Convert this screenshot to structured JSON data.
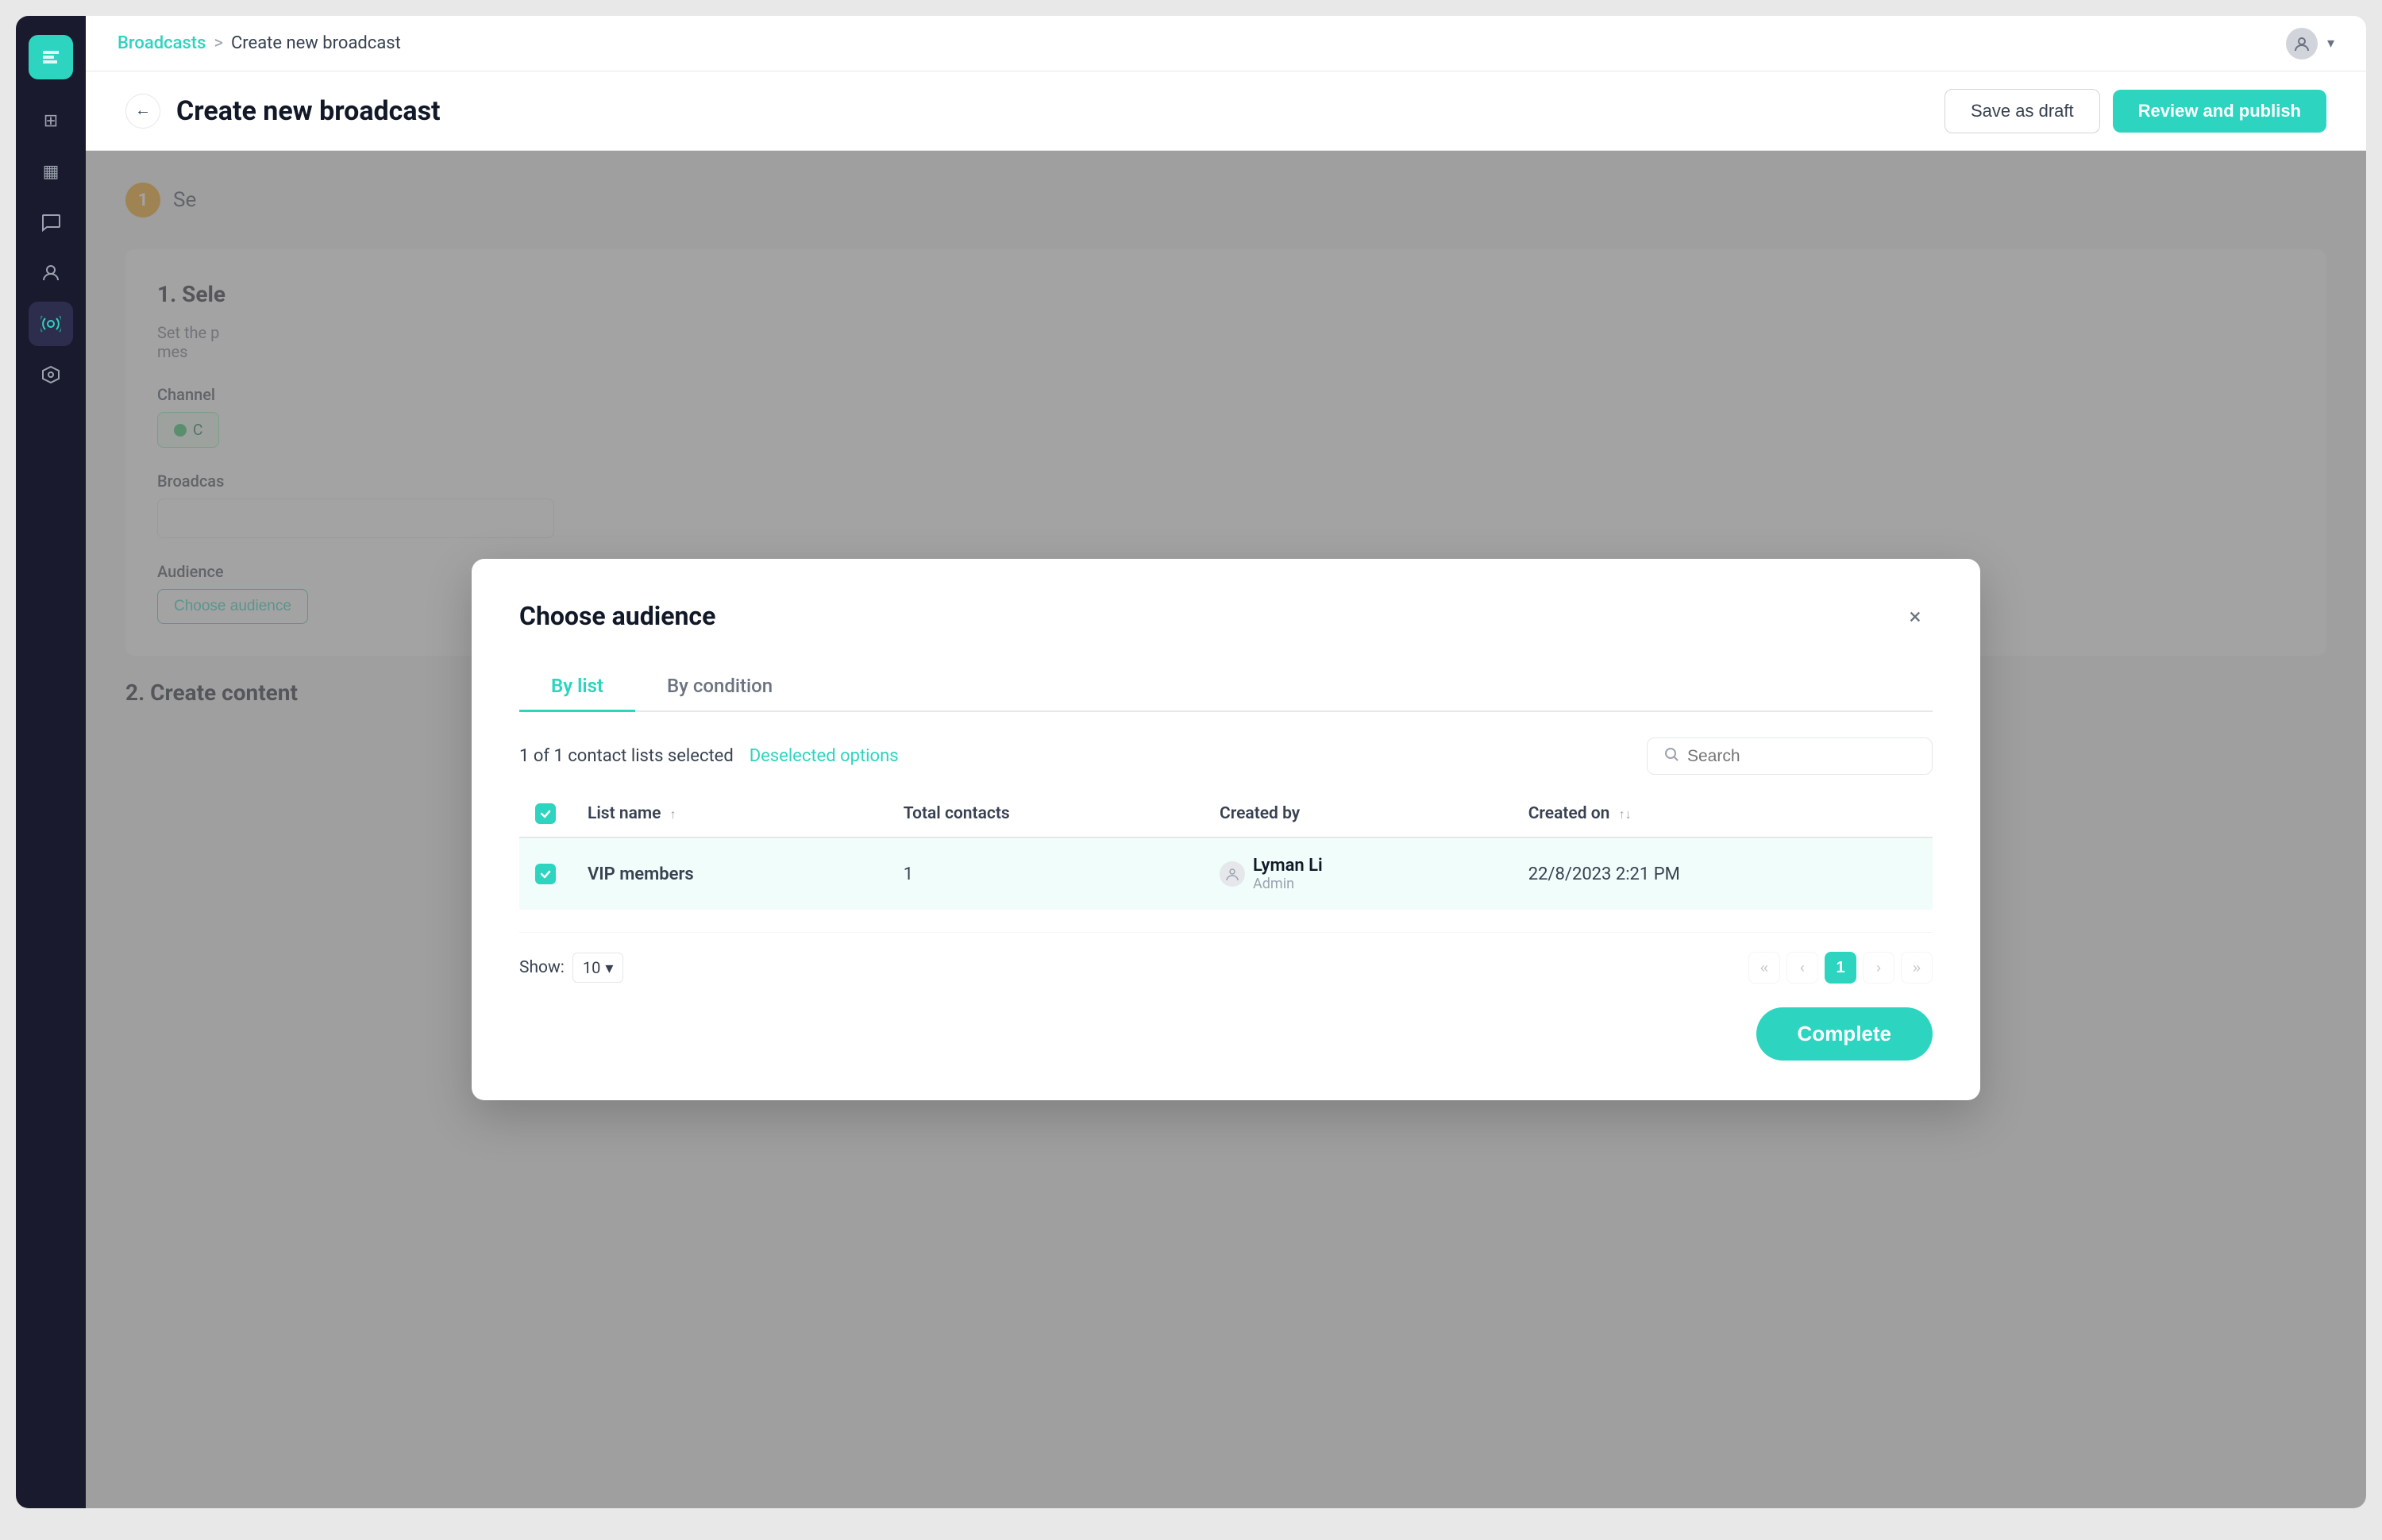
{
  "app": {
    "title": "Create new broadcast"
  },
  "breadcrumb": {
    "parent": "Broadcasts",
    "separator": ">",
    "current": "Create new broadcast"
  },
  "header": {
    "back_button_label": "←",
    "page_title": "Create new broadcast",
    "save_draft_label": "Save as draft",
    "publish_label": "Review and publish"
  },
  "page": {
    "step_number": "1",
    "step_label": "Se",
    "section_title": "1. Sele",
    "section_desc": "Set the p",
    "channel_label": "Channel",
    "channel_value": "C",
    "broadcast_label": "Broadcas",
    "audience_label": "Audience",
    "audience_btn": "Choose audience",
    "section2_title": "2. Create content"
  },
  "modal": {
    "title": "Choose audience",
    "close_label": "×",
    "tabs": [
      {
        "id": "by-list",
        "label": "By list",
        "active": true
      },
      {
        "id": "by-condition",
        "label": "By condition",
        "active": false
      }
    ],
    "toolbar": {
      "selected_text": "1 of 1 contact lists selected",
      "deselect_text": "Deselected options",
      "search_placeholder": "Search"
    },
    "table": {
      "columns": [
        {
          "key": "checkbox",
          "label": ""
        },
        {
          "key": "list_name",
          "label": "List name",
          "sort": "asc"
        },
        {
          "key": "total_contacts",
          "label": "Total contacts"
        },
        {
          "key": "created_by",
          "label": "Created by"
        },
        {
          "key": "created_on",
          "label": "Created on",
          "sort": "both"
        }
      ],
      "rows": [
        {
          "id": 1,
          "checked": true,
          "list_name": "VIP members",
          "total_contacts": "1",
          "created_by_name": "Lyman Li",
          "created_by_role": "Admin",
          "created_on": "22/8/2023 2:21 PM",
          "selected": true
        }
      ]
    },
    "pagination": {
      "show_label": "Show:",
      "show_value": "10",
      "current_page": "1"
    },
    "complete_button": "Complete"
  },
  "sidebar": {
    "items": [
      {
        "id": "dashboard",
        "icon": "⊞",
        "active": false
      },
      {
        "id": "grid",
        "icon": "▦",
        "active": false
      },
      {
        "id": "chat",
        "icon": "💬",
        "active": false
      },
      {
        "id": "contacts",
        "icon": "👤",
        "active": false
      },
      {
        "id": "broadcast",
        "icon": "◎",
        "active": true
      },
      {
        "id": "integrations",
        "icon": "⬡",
        "active": false
      }
    ]
  }
}
